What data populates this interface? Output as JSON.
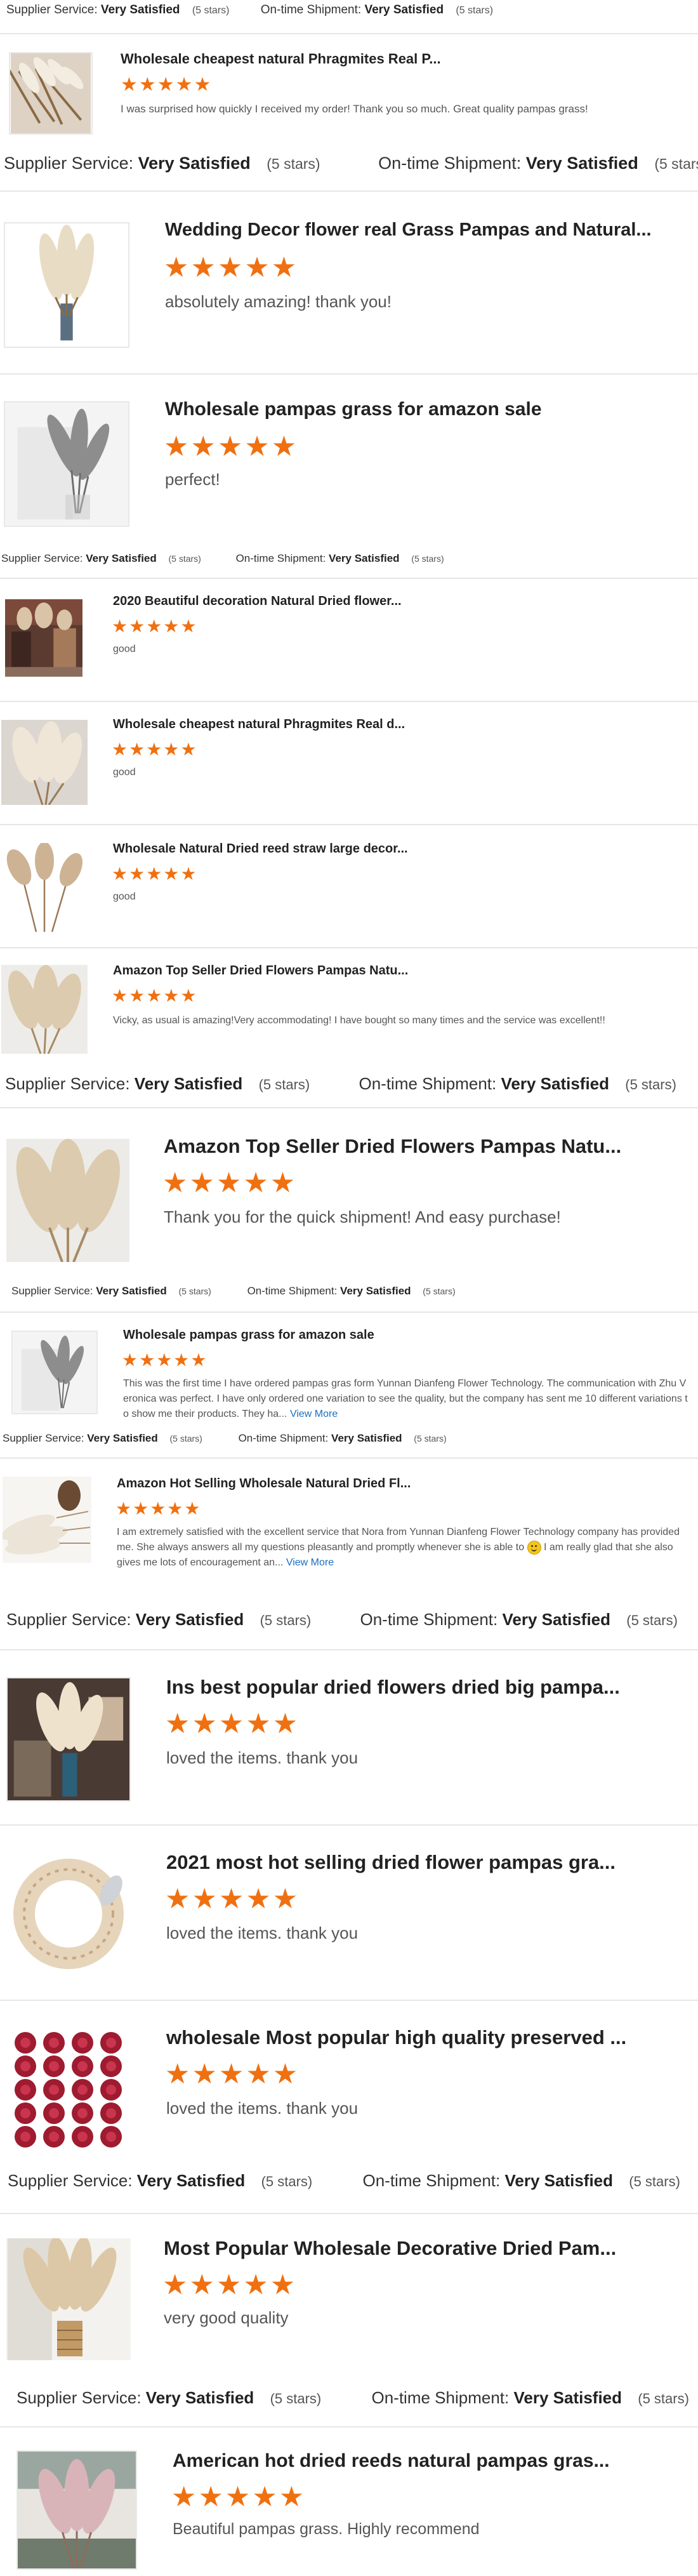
{
  "rating_summary": {
    "supplier_label": "Supplier Service:",
    "shipment_label": "On-time Shipment:",
    "value": "Very Satisfied",
    "stars": "(5 stars)"
  },
  "stars": "★★★★★",
  "view_more": "View More",
  "reviews": [
    {
      "title": "Wholesale cheapest natural Phragmites Real P...",
      "comment": "I was surprised how quickly I received my order! Thank you so much. Great quality pampas grass!",
      "thumb_icon": "pampas-bundle-image"
    },
    {
      "title": "Wedding Decor flower real Grass Pampas and Natural...",
      "comment": "absolutely amazing! thank you!",
      "thumb_icon": "pampas-vase-image"
    },
    {
      "title": "Wholesale pampas grass for amazon sale",
      "comment": "perfect!",
      "thumb_icon": "grey-pampas-image"
    },
    {
      "title": "2020 Beautiful decoration Natural Dried flower...",
      "comment": "good",
      "thumb_icon": "decorated-room-image"
    },
    {
      "title": "Wholesale cheapest natural Phragmites Real d...",
      "comment": "good",
      "thumb_icon": "pampas-plumes-image"
    },
    {
      "title": "Wholesale Natural Dried reed straw large decor...",
      "comment": "good",
      "thumb_icon": "dried-reed-image"
    },
    {
      "title": "Amazon Top Seller Dried Flowers Pampas Natu...",
      "comment": "Vicky, as usual is amazing!Very accommodating! I have bought so many times and the service was excellent!!",
      "thumb_icon": "beige-pampas-image"
    },
    {
      "title": "Amazon Top Seller Dried Flowers Pampas Natu...",
      "comment": "Thank you for the quick shipment! And easy purchase!",
      "thumb_icon": "beige-pampas-image"
    },
    {
      "title": "Wholesale pampas grass for amazon sale",
      "comment": "This was the first time I have ordered pampas gras form Yunnan Dianfeng Flower Technology. The communication with Zhu Veronica was perfect. I have only ordered one variation to see the quality, but the company has sent me 10 different variations to show me their products. They ha...",
      "thumb_icon": "grey-pampas-image"
    },
    {
      "title": "Amazon Hot Selling Wholesale Natural Dried Fl...",
      "comment": "I am extremely satisfied with the excellent service that Nora from Yunnan Dianfeng Flower Technology company has provided me. She always answers all my questions pleasantly and promptly whenever she is able to",
      "comment_tail": "I am really glad that she also gives me lots of encouragement an...",
      "thumb_icon": "pampas-pinecone-image"
    },
    {
      "title": "Ins best popular dried flowers dried big pampa...",
      "comment": "loved the items. thank you",
      "thumb_icon": "pampas-room-image"
    },
    {
      "title": "2021 most hot selling dried flower pampas gra...",
      "comment": "loved the items. thank you",
      "thumb_icon": "pampas-wreath-image"
    },
    {
      "title": "wholesale Most popular high quality preserved ...",
      "comment": "loved the items. thank you",
      "thumb_icon": "preserved-roses-image"
    },
    {
      "title": "Most Popular Wholesale Decorative Dried Pam...",
      "comment": "very good quality",
      "thumb_icon": "pampas-vase-image"
    },
    {
      "title": "American hot dried reeds natural pampas gras...",
      "comment": "Beautiful pampas grass. Highly recommend",
      "thumb_icon": "pink-pampas-image"
    }
  ]
}
